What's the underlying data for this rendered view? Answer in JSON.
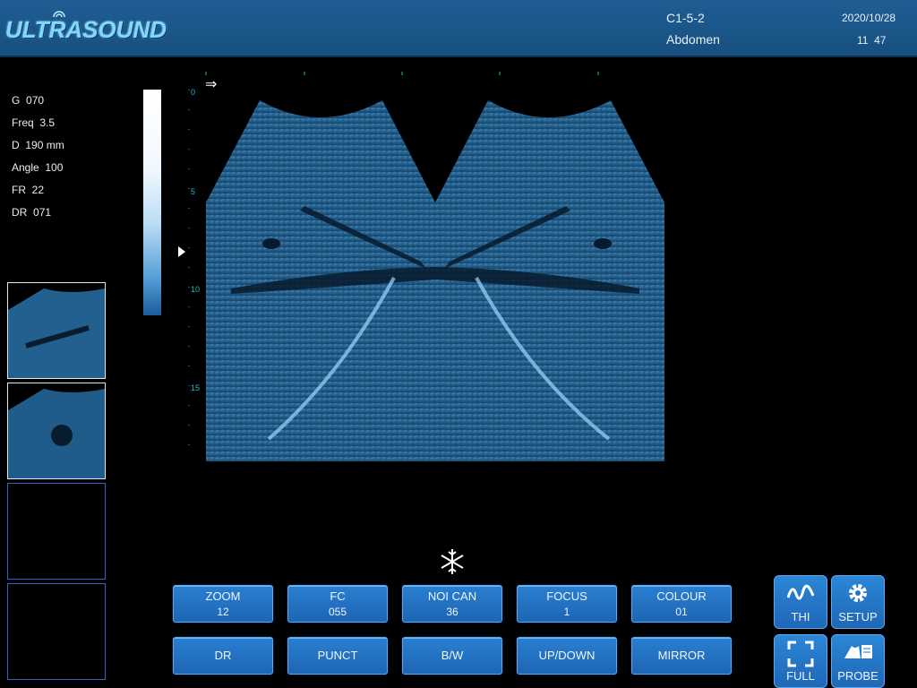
{
  "header": {
    "logo": "ULTRASOUND",
    "probe": "C1-5-2",
    "preset": "Abdomen",
    "date": "2020/10/28",
    "time": "11  47"
  },
  "params": [
    {
      "label": "G",
      "value": "070"
    },
    {
      "label": "Freq",
      "value": "3.5"
    },
    {
      "label": "D",
      "value": "190 mm"
    },
    {
      "label": "Angle",
      "value": "100"
    },
    {
      "label": "FR",
      "value": "22"
    },
    {
      "label": "DR",
      "value": "071"
    }
  ],
  "depth_scale": [
    "0",
    "5",
    "10",
    "15"
  ],
  "controls": [
    {
      "label": "ZOOM",
      "value": "12"
    },
    {
      "label": "FC",
      "value": "055"
    },
    {
      "label": "NOI CAN",
      "value": "36"
    },
    {
      "label": "FOCUS",
      "value": "1"
    },
    {
      "label": "COLOUR",
      "value": "01"
    }
  ],
  "actions": [
    "DR",
    "PUNCT",
    "B/W",
    "UP/DOWN",
    "MIRROR"
  ],
  "system_buttons": [
    "THI",
    "SETUP",
    "FULL",
    "PROBE"
  ],
  "colors": {
    "accent": "#2a7fd0",
    "header": "#1b568a",
    "scale": "#2bb4c8"
  }
}
